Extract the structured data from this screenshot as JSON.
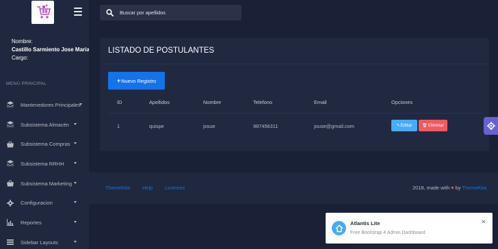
{
  "header": {
    "search_placeholder": "Buscar por apellidos"
  },
  "user": {
    "nombre_label": "Nombre:",
    "nombre_value": "Castillo Sarmiento Jose Maria Hernan",
    "cargo_label": "Cargo:"
  },
  "sidebar": {
    "section_label": "MENÚ PRINCIPAL",
    "items": [
      {
        "label": "Mantenedores Principales",
        "icon": "layers-icon"
      },
      {
        "label": "Subsistema Almacén",
        "icon": "layers-icon"
      },
      {
        "label": "Subsistema Compras",
        "icon": "basket-icon"
      },
      {
        "label": "Subsistema RRHH",
        "icon": "layers-icon"
      },
      {
        "label": "Subsistema Marketing",
        "icon": "basket-icon"
      },
      {
        "label": "Configuracion",
        "icon": "gear-icon"
      },
      {
        "label": "Reportes",
        "icon": "chart-icon"
      },
      {
        "label": "Sidebar Layouts",
        "icon": "bars-icon"
      }
    ]
  },
  "card": {
    "title": "LISTADO DE POSTULANTES",
    "new_button": "Nuevo Registro",
    "columns": [
      "ID",
      "Apellidos",
      "Nombre",
      "Telefono",
      "Email",
      "Opciones"
    ],
    "rows": [
      {
        "id": "1",
        "apellidos": "quispe",
        "nombre": "josue",
        "telefono": "987456311",
        "email": "jouse@gmail.com",
        "edit_label": "Editar",
        "delete_label": "Eliminar"
      }
    ]
  },
  "footer": {
    "links": [
      "ThemeKita",
      "Help",
      "Licenses"
    ],
    "copy_prefix": "2018, made with",
    "copy_by": "by",
    "copy_brand": "ThemeKita"
  },
  "toast": {
    "title": "Atlantis Lite",
    "message": "Free Bootstrap 4 Admin Dashboard",
    "close": "×"
  },
  "colors": {
    "primary": "#1572e8",
    "info": "#48abf7",
    "danger": "#f25961",
    "secondary": "#6861ce"
  }
}
